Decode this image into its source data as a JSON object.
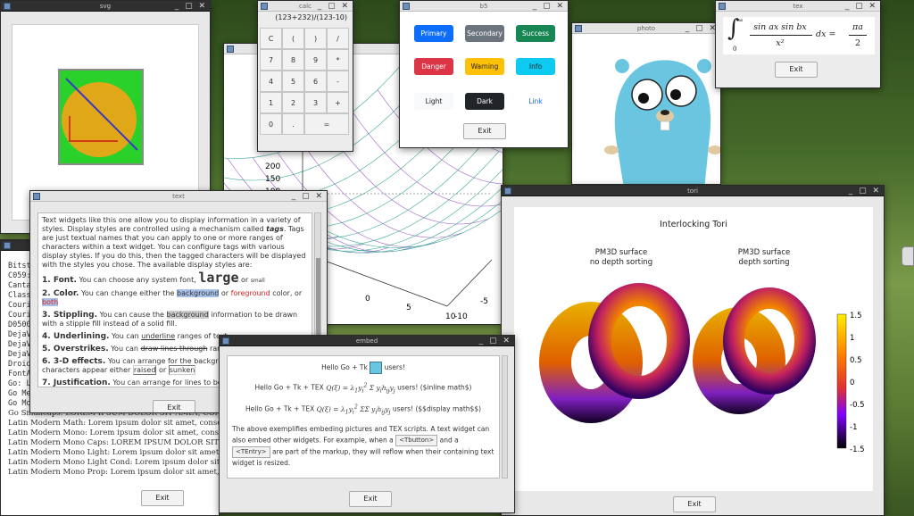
{
  "colors": {
    "bs_primary": "#0d6efd",
    "bs_secondary": "#6c757d",
    "bs_success": "#198754",
    "bs_danger": "#dc3545",
    "bs_warning": "#ffc107",
    "bs_info": "#0dcaf0",
    "bs_dark": "#212529",
    "bs_light": "#f8f9fa",
    "desktop": "#4e6f31"
  },
  "svg_win": {
    "title": "svg"
  },
  "fonts_win": {
    "title": "",
    "exit": "Exit",
    "lines": [
      "Bitstream",
      "C059:",
      "Cantarell",
      "Class",
      "Couri",
      "Couri",
      "D050000",
      "DejaV",
      "DejaV",
      "DejaV",
      "Droid",
      "FontA",
      "Go: L",
      "Go Me",
      "Go Mono:",
      "Go Smallcaps: LOREM IPSUM DOLOR SIT AMET, CONSECTETUR A",
      "Latin Modern Math: Lorem ipsum dolor sit amet, consectetur a",
      "Latin Modern Mono: Lorem ipsum dolor sit amet, consecte",
      "Latin Modern Mono Caps: LOREM IPSUM DOLOR SIT AMET, CONS",
      "Latin Modern Mono Light: Lorem ipsum dolor sit amet, consec",
      "Latin Modern Mono Light Cond: Lorem ipsum dolor sit amet, consect",
      "Latin Modern Mono Prop: Lorem ipsum dolor sit amet, consect"
    ]
  },
  "plot_win": {
    "ticks_y": [
      "200",
      "150",
      "100",
      "50"
    ],
    "ticks_x": [
      "0",
      "5",
      "10"
    ],
    "ticks_x2": [
      "-5",
      "-10"
    ]
  },
  "calc": {
    "title": "calc",
    "display": "(123+232)/(123-10)",
    "keys": [
      "C",
      "(",
      ")",
      "/",
      "7",
      "8",
      "9",
      "*",
      "4",
      "5",
      "6",
      "-",
      "1",
      "2",
      "3",
      "+",
      "0",
      ".",
      "="
    ]
  },
  "b5": {
    "title": "b5",
    "buttons": [
      "Primary",
      "Secondary",
      "Success",
      "Danger",
      "Warning",
      "Info",
      "Light",
      "Dark",
      "Link"
    ],
    "exit": "Exit"
  },
  "photo": {
    "title": "photo"
  },
  "tex": {
    "title": "tex",
    "formula_sym": "∫",
    "lower": "0",
    "upper": "∞",
    "num": "sin ax sin bx",
    "den": "x²",
    "dx": "dx =",
    "pi": "πa",
    "two": "2",
    "exit": "Exit"
  },
  "text_win": {
    "title": "text",
    "intro": "Text widgets like this one allow you to display information in a variety of styles. Display styles are controlled using a mechanism called",
    "tags": "tags",
    "intro2": ". Tags are just textual names that you can apply to one or more ranges of characters within a text widget. You can configure tags with various display styles. If you do this, then the tagged characters will be displayed with the styles you chose. The available display styles are:",
    "i1_title": "1. Font.",
    "i1_text": "You can choose any system font,",
    "i1_large": "large",
    "i1_or": "or",
    "i1_small": "small",
    "i2_title": "2. Color.",
    "i2_a": "You can change either the",
    "i2_bg": "background",
    "i2_or": "or",
    "i2_fg": "foreground",
    "i2_c": "color, or",
    "i2_both": "both",
    "i3_title": "3. Stippling.",
    "i3_a": "You can cause the",
    "i3_bg": "background",
    "i3_b": "information to be drawn with a stipple fill instead of a solid fill.",
    "i4_title": "4. Underlining.",
    "i4_a": "You can",
    "i4_u": "underline",
    "i4_b": "ranges of text.",
    "i5_title": "5. Overstrikes.",
    "i5_a": "You can",
    "i5_s": "draw lines through",
    "i5_b": "ranges of text.",
    "i6_title": "6. 3-D effects.",
    "i6_a": "You can arrange for the background to be drawn with a",
    "i6_b": "characters appear either",
    "i6_r": "raised",
    "i6_or": "or",
    "i6_su": "sunken",
    "i7_title": "7. Justification.",
    "i7_a": "You can arrange for lines to be displayed",
    "exit": "Exit"
  },
  "embed": {
    "title": "embed",
    "hello1": "Hello Go + Tk",
    "users": "users!",
    "hello2": "Hello Go + Tk + TEX",
    "inl": "users! ($inline math$)",
    "hello3": "Hello Go + Tk + TEX",
    "disp": "users! ($$display math$$)",
    "para1": "The above exemplifies embeding pictures and TEX scripts. A text widget can also embed other widgets. For example, when a",
    "tbutton": "<Tbutton>",
    "and": "and a",
    "tentry": "<TEntry>",
    "para2": "are part of the markup, they will reflow when their containing text widget is resized.",
    "exit": "Exit"
  },
  "tori": {
    "title": "tori",
    "heading": "Interlocking Tori",
    "left1": "PM3D surface",
    "left2": "no depth sorting",
    "right1": "PM3D surface",
    "right2": "depth sorting",
    "cbar_ticks": [
      "1.5",
      "1",
      "0.5",
      "0",
      "-0.5",
      "-1",
      "-1.5"
    ],
    "exit": "Exit"
  }
}
